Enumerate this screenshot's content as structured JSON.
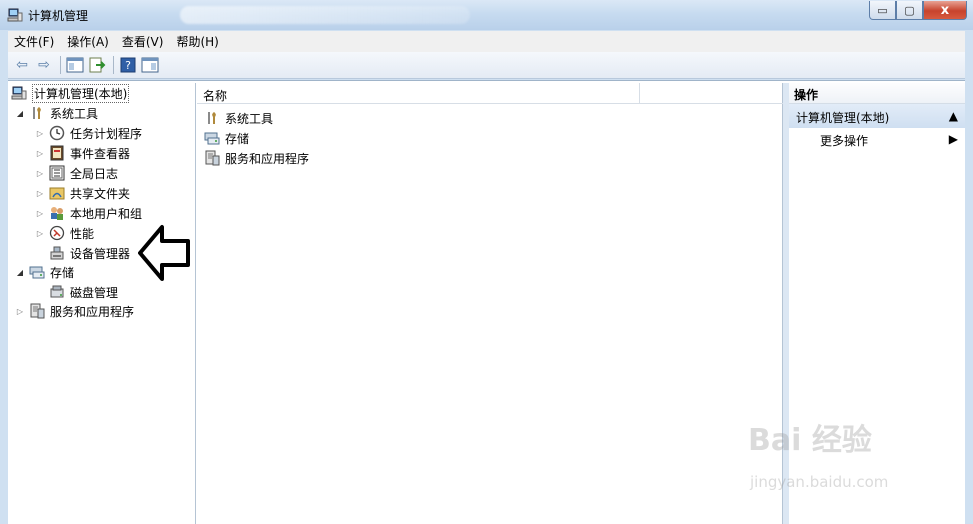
{
  "window": {
    "title": "计算机管理",
    "buttons": {
      "minimize": "▭",
      "maximize": "▢",
      "close": "x"
    }
  },
  "menu": [
    "文件(F)",
    "操作(A)",
    "查看(V)",
    "帮助(H)"
  ],
  "toolbar": {
    "icons": [
      "back-arrow-icon",
      "forward-arrow-icon",
      "console-tree-icon",
      "export-list-icon",
      "help-icon",
      "show-hide-action-pane-icon"
    ],
    "glyphs": {
      "back": "⇦",
      "forward": "⇨",
      "help": "?"
    }
  },
  "tree": [
    {
      "label": "计算机管理(本地)",
      "expanded": true,
      "selected": true
    },
    {
      "label": "系统工具",
      "expanded": true
    },
    {
      "label": "任务计划程序",
      "expanded": false
    },
    {
      "label": "事件查看器",
      "expanded": false
    },
    {
      "label": "全局日志",
      "expanded": false
    },
    {
      "label": "共享文件夹",
      "expanded": false
    },
    {
      "label": "本地用户和组",
      "expanded": false
    },
    {
      "label": "性能",
      "expanded": false
    },
    {
      "label": "设备管理器"
    },
    {
      "label": "存储",
      "expanded": true
    },
    {
      "label": "磁盘管理"
    },
    {
      "label": "服务和应用程序",
      "expanded": false
    }
  ],
  "arrows": {
    "collapsed": "▷",
    "expanded": "◢"
  },
  "list": {
    "column_header": "名称",
    "items": [
      "系统工具",
      "存储",
      "服务和应用程序"
    ]
  },
  "actions": {
    "header": "操作",
    "section": "计算机管理(本地)",
    "section_glyph": "▲",
    "more": "更多操作",
    "more_glyph": "▶"
  },
  "watermark": {
    "brand": "Bai 经验",
    "url": "jingyan.baidu.com"
  },
  "colors": {
    "accent": "#cfe0f1",
    "close_button": "#c7432d",
    "section_bg": "#d9e6f5"
  }
}
